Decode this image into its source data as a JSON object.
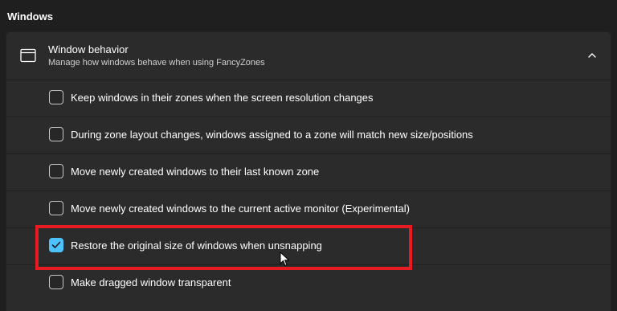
{
  "section": {
    "title": "Windows"
  },
  "card": {
    "icon": "window-icon",
    "title": "Window behavior",
    "description": "Manage how windows behave when using FancyZones",
    "expand_icon": "chevron-up-icon"
  },
  "options": [
    {
      "label": "Keep windows in their zones when the screen resolution changes",
      "checked": false
    },
    {
      "label": "During zone layout changes, windows assigned to a zone will match new size/positions",
      "checked": false
    },
    {
      "label": "Move newly created windows to their last known zone",
      "checked": false
    },
    {
      "label": "Move newly created windows to the current active monitor (Experimental)",
      "checked": false
    },
    {
      "label": "Restore the original size of windows when unsnapping",
      "checked": true
    },
    {
      "label": "Make dragged window transparent",
      "checked": false
    }
  ],
  "colors": {
    "accent": "#4cc2ff",
    "highlight": "#e81b23",
    "background": "#1f1f1f",
    "card": "#2b2b2b"
  }
}
